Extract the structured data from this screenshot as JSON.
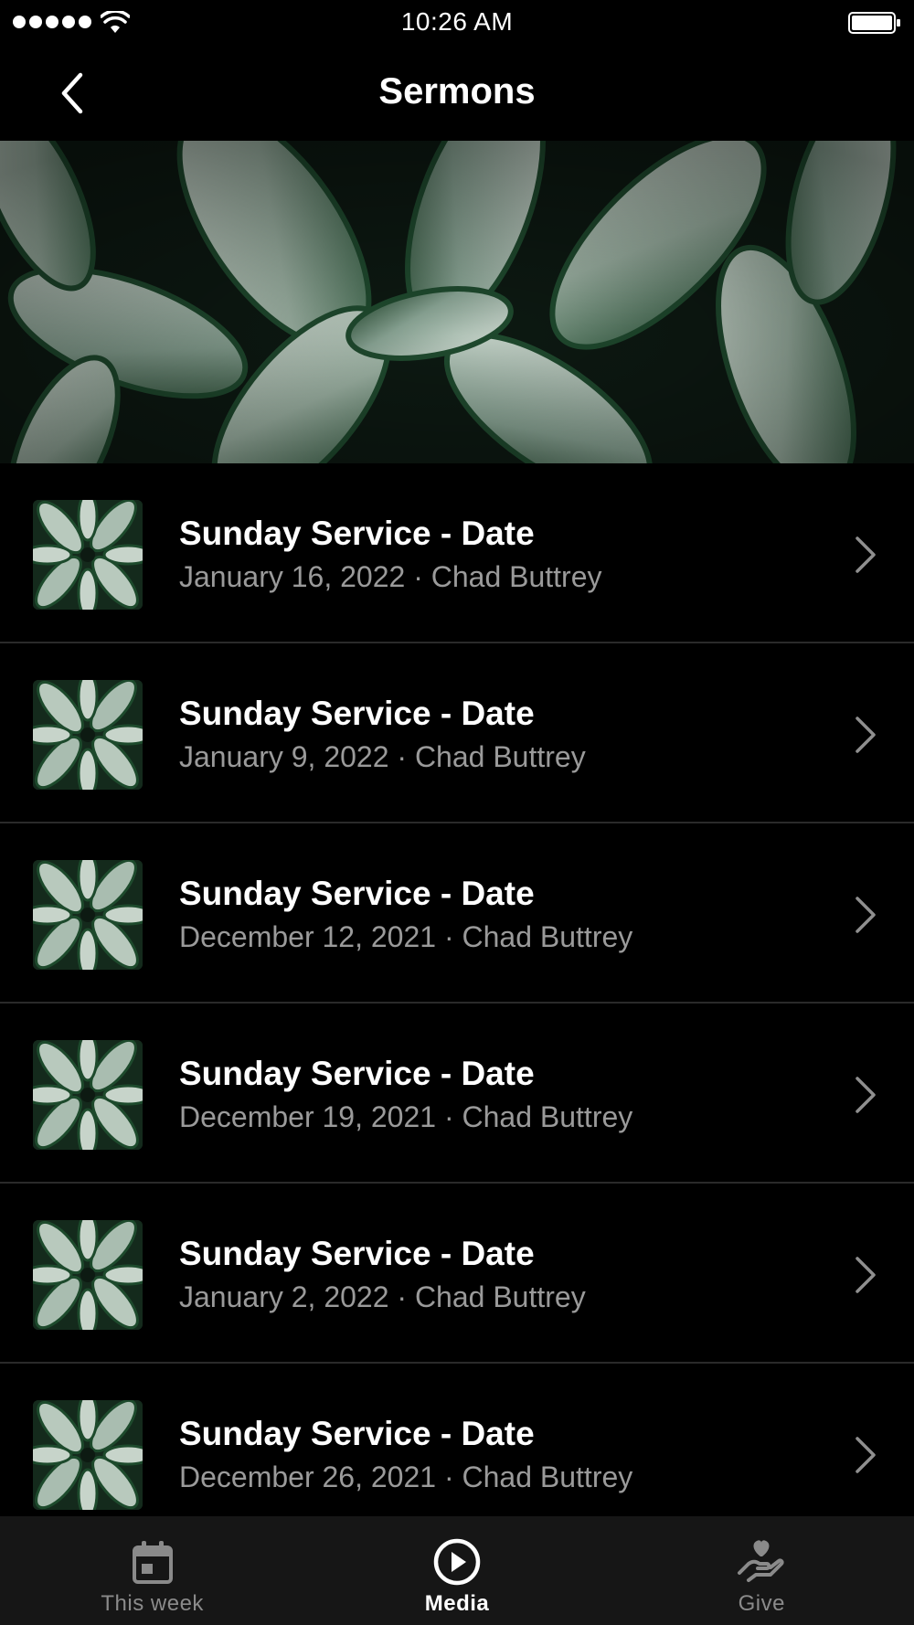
{
  "status_bar": {
    "time": "10:26 AM"
  },
  "nav": {
    "title": "Sermons",
    "back_icon": "chevron-left-icon"
  },
  "hero": {
    "image": "leaves-banner"
  },
  "sermons": [
    {
      "title": "Sunday Service - Date",
      "subtitle": "January 16, 2022 · Chad Buttrey"
    },
    {
      "title": "Sunday Service - Date",
      "subtitle": "January 9, 2022 · Chad Buttrey"
    },
    {
      "title": "Sunday Service - Date",
      "subtitle": "December 12, 2021 · Chad Buttrey"
    },
    {
      "title": "Sunday Service - Date",
      "subtitle": "December 19, 2021 · Chad Buttrey"
    },
    {
      "title": "Sunday Service - Date",
      "subtitle": "January 2, 2022 · Chad Buttrey"
    },
    {
      "title": "Sunday Service - Date",
      "subtitle": "December 26, 2021 · Chad Buttrey"
    }
  ],
  "tab_bar": {
    "tabs": [
      {
        "label": "This week",
        "icon": "calendar-icon",
        "active": false
      },
      {
        "label": "Media",
        "icon": "play-circle-icon",
        "active": true
      },
      {
        "label": "Give",
        "icon": "hand-heart-icon",
        "active": false
      }
    ]
  },
  "colors": {
    "background": "#000000",
    "tab_bar_background": "#161616",
    "subtitle_text": "#9a9a9a",
    "inactive_tab": "#8a8a8a",
    "divider": "#2a2a2a"
  }
}
